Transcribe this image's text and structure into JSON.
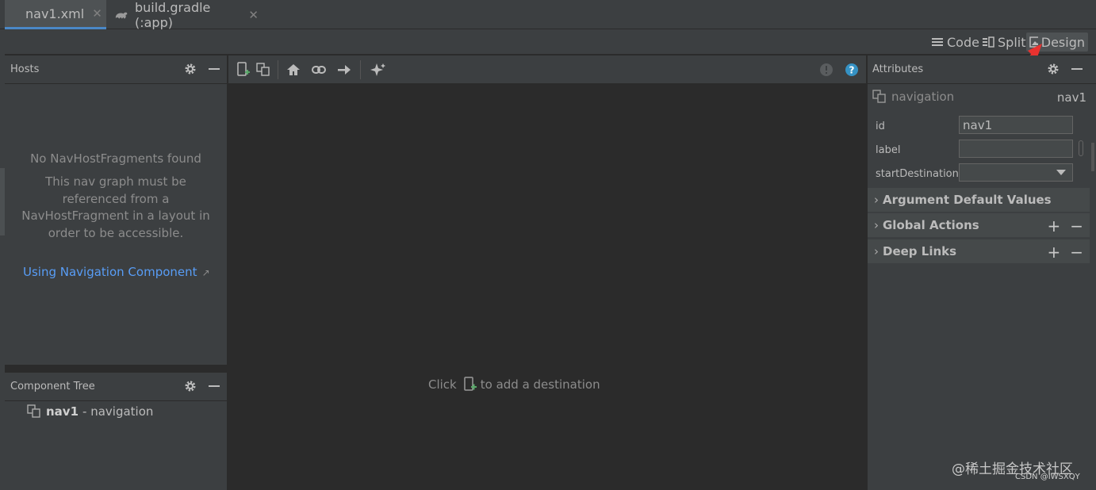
{
  "tabs": [
    {
      "label": "nav1.xml",
      "icon": "xml-file-icon",
      "active": true
    },
    {
      "label": "build.gradle (:app)",
      "icon": "gradle-icon",
      "active": false
    }
  ],
  "modes": {
    "code": "Code",
    "split": "Split",
    "design": "Design",
    "selected": "Design"
  },
  "hosts": {
    "title": "Hosts",
    "empty_title": "No NavHostFragments found",
    "empty_lines": [
      "This nav graph must be",
      "referenced from a",
      "NavHostFragment in a layout in",
      "order to be accessible."
    ],
    "link": "Using Navigation Component",
    "link_arrow": "↗"
  },
  "component_tree": {
    "title": "Component Tree",
    "item_id": "nav1",
    "item_type": "- navigation"
  },
  "canvas": {
    "hint_prefix": "Click",
    "hint_suffix": "to add a destination"
  },
  "attributes": {
    "title": "Attributes",
    "element_type": "navigation",
    "element_id": "nav1",
    "fields": [
      {
        "label": "id",
        "value": "nav1"
      },
      {
        "label": "label",
        "value": ""
      },
      {
        "label": "startDestination",
        "value": ""
      }
    ],
    "sections": [
      {
        "label": "Argument Default Values",
        "has_actions": false
      },
      {
        "label": "Global Actions",
        "has_actions": true
      },
      {
        "label": "Deep Links",
        "has_actions": true
      }
    ]
  },
  "watermark": {
    "line1": "@稀土掘金技术社区",
    "line2": "CSDN @IWSXQY"
  },
  "colors": {
    "accent": "#4a88c7",
    "link": "#589df6",
    "annotation_arrow": "#e8322f",
    "help": "#3592c4"
  }
}
